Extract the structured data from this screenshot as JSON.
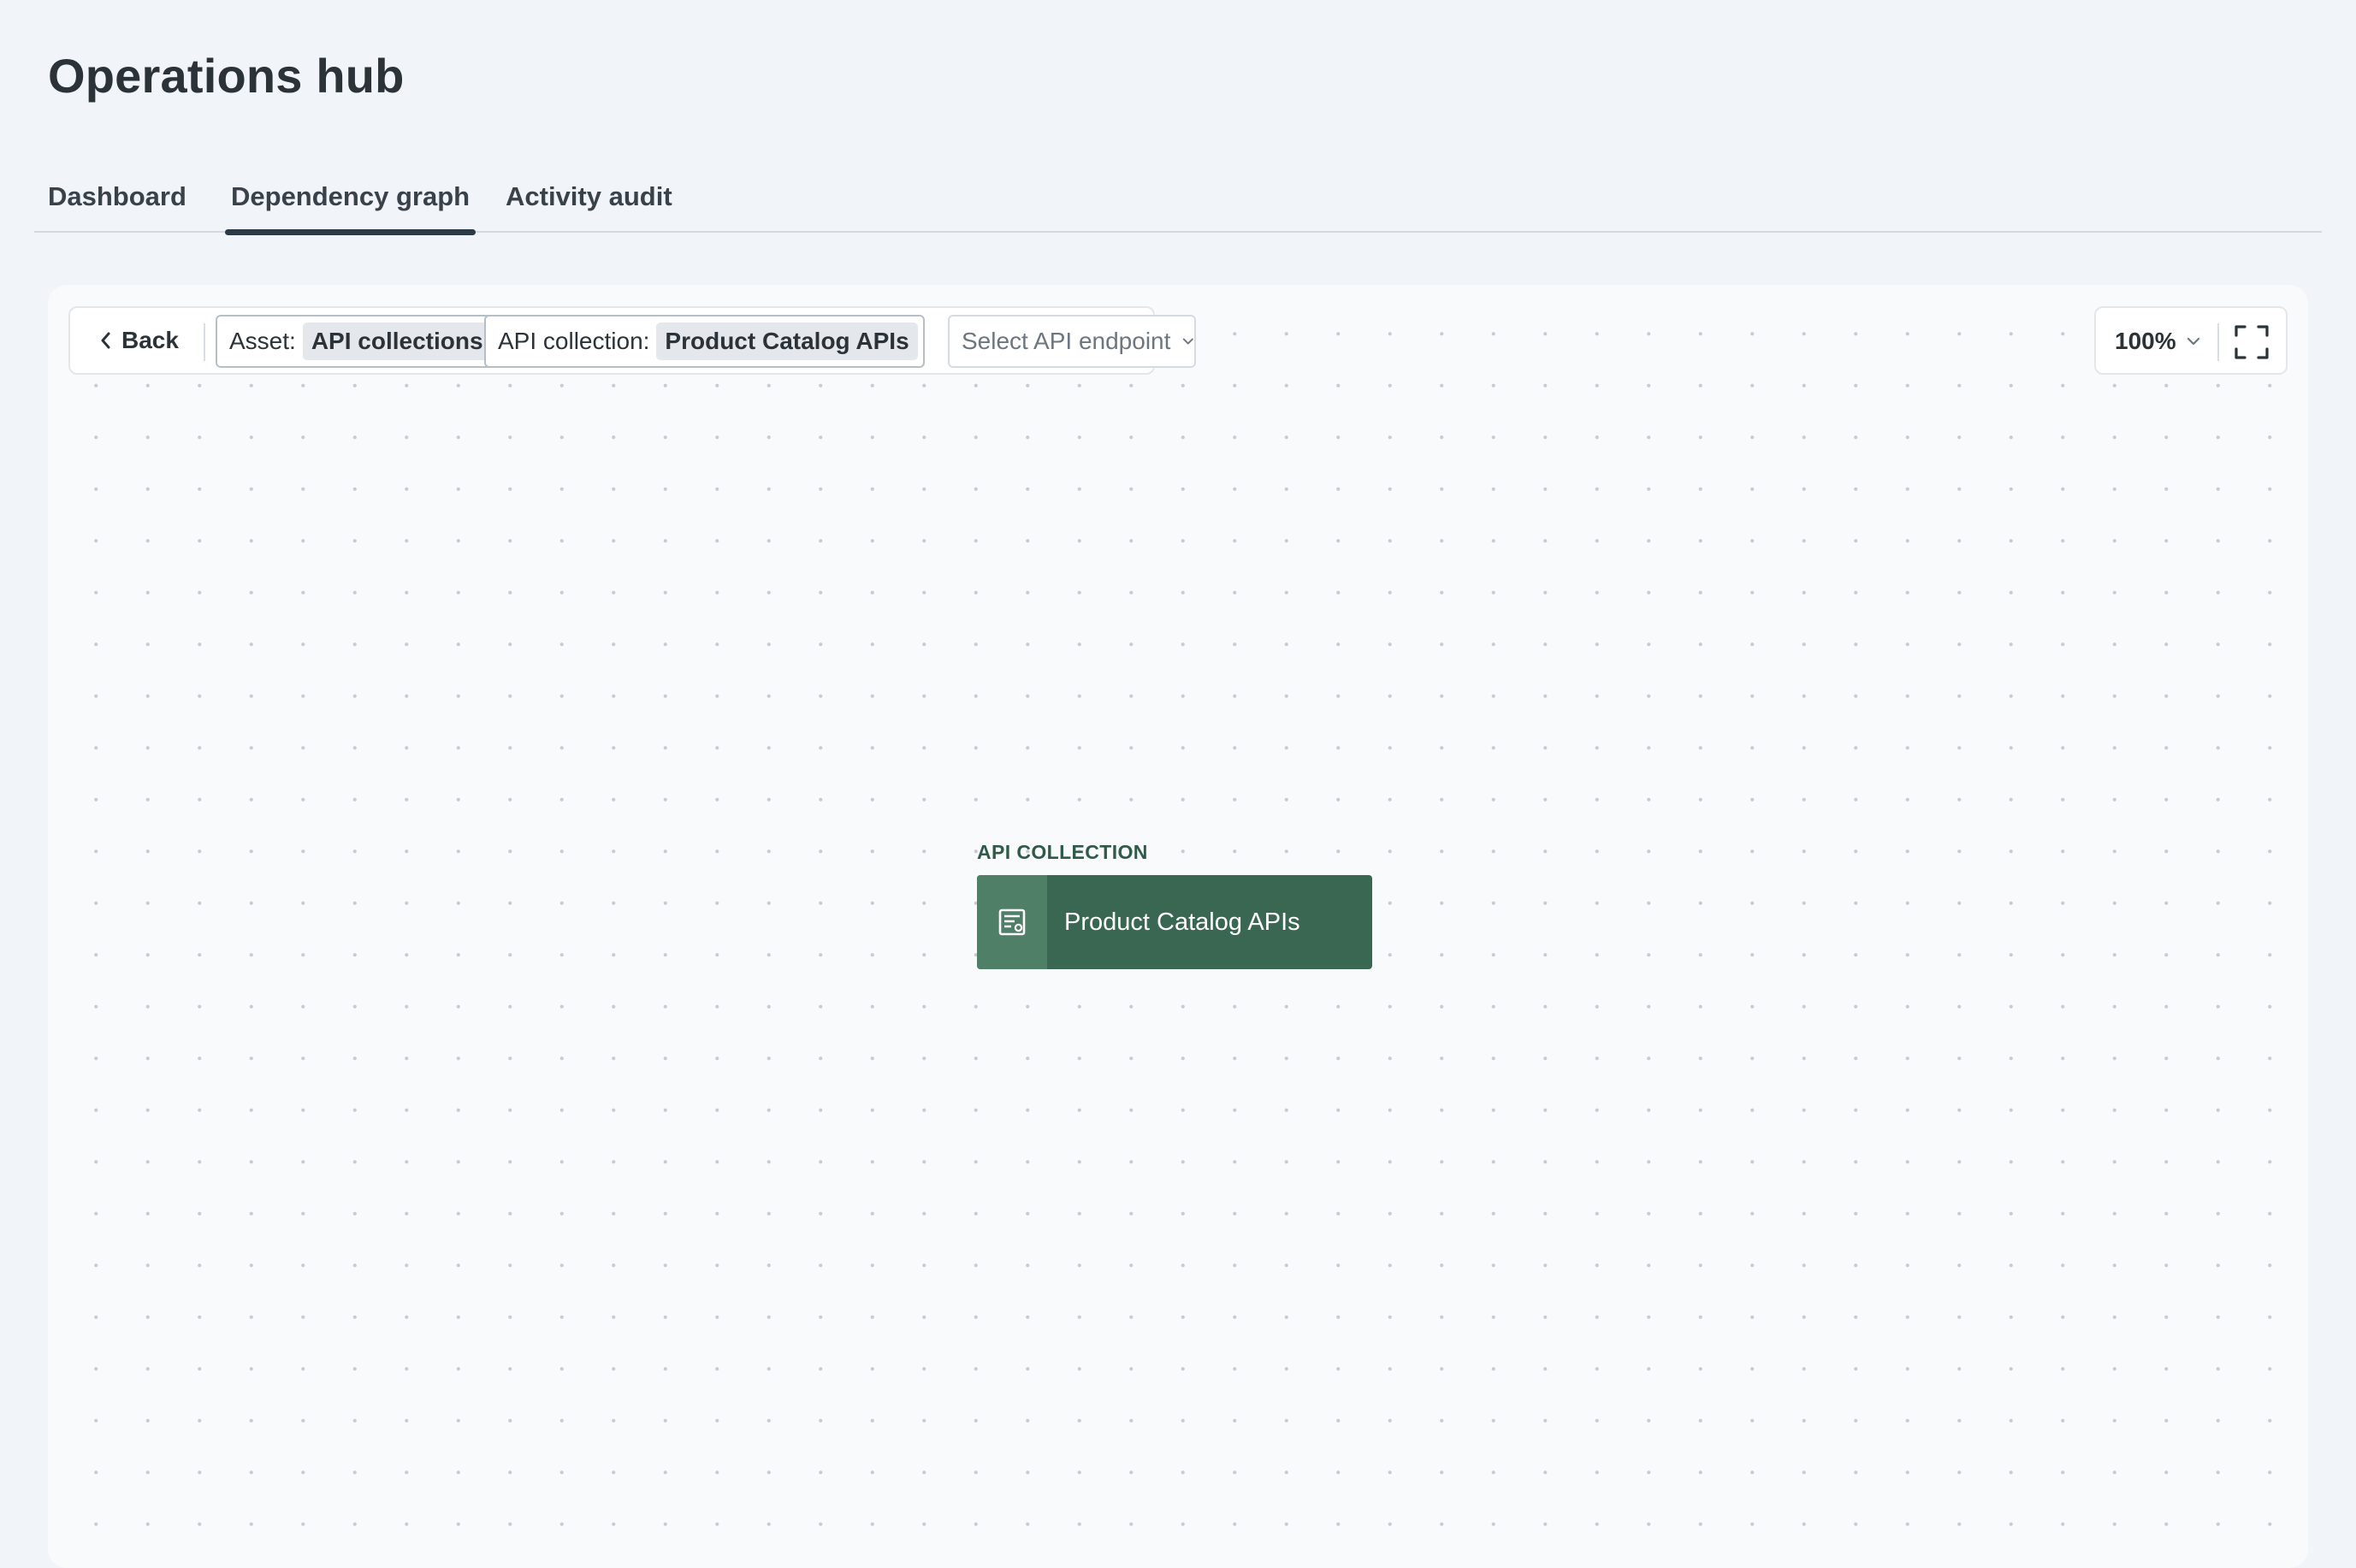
{
  "page": {
    "title": "Operations hub"
  },
  "tabs": [
    {
      "label": "Dashboard",
      "active": false
    },
    {
      "label": "Dependency graph",
      "active": true
    },
    {
      "label": "Activity audit",
      "active": false
    }
  ],
  "toolbar": {
    "back_label": "Back",
    "asset_chip": {
      "label": "Asset:",
      "value": "API collections"
    },
    "collection_chip": {
      "label": "API collection:",
      "value": "Product Catalog APIs"
    },
    "endpoint_select": {
      "placeholder": "Select API endpoint"
    },
    "zoom": {
      "value": "100%"
    }
  },
  "graph": {
    "nodes": [
      {
        "type_label": "API COLLECTION",
        "name": "Product Catalog APIs",
        "icon": "api-collection-icon",
        "color": "#3a6751"
      }
    ]
  },
  "colors": {
    "accent": "#2b3a47",
    "node_fill": "#3a6751",
    "node_icon_fill": "#4f7f67",
    "node_caption": "#2f5a45"
  }
}
